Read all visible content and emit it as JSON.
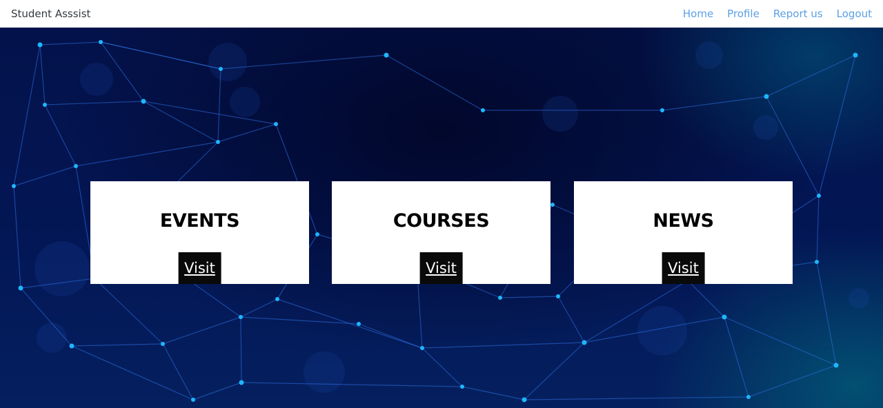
{
  "navbar": {
    "brand": "Student Asssist",
    "links": [
      {
        "label": "Home"
      },
      {
        "label": "Profile"
      },
      {
        "label": "Report us"
      },
      {
        "label": "Logout"
      }
    ]
  },
  "cards": [
    {
      "title": "EVENTS",
      "button_label": "Visit"
    },
    {
      "title": "COURSES",
      "button_label": "Visit"
    },
    {
      "title": "NEWS",
      "button_label": "Visit"
    }
  ],
  "colors": {
    "nav_link": "#5aa0e6",
    "brand_text": "#343a40",
    "hero_background": "#031655",
    "network_line": "#2d6fe0",
    "network_node": "#1fb6ff"
  }
}
